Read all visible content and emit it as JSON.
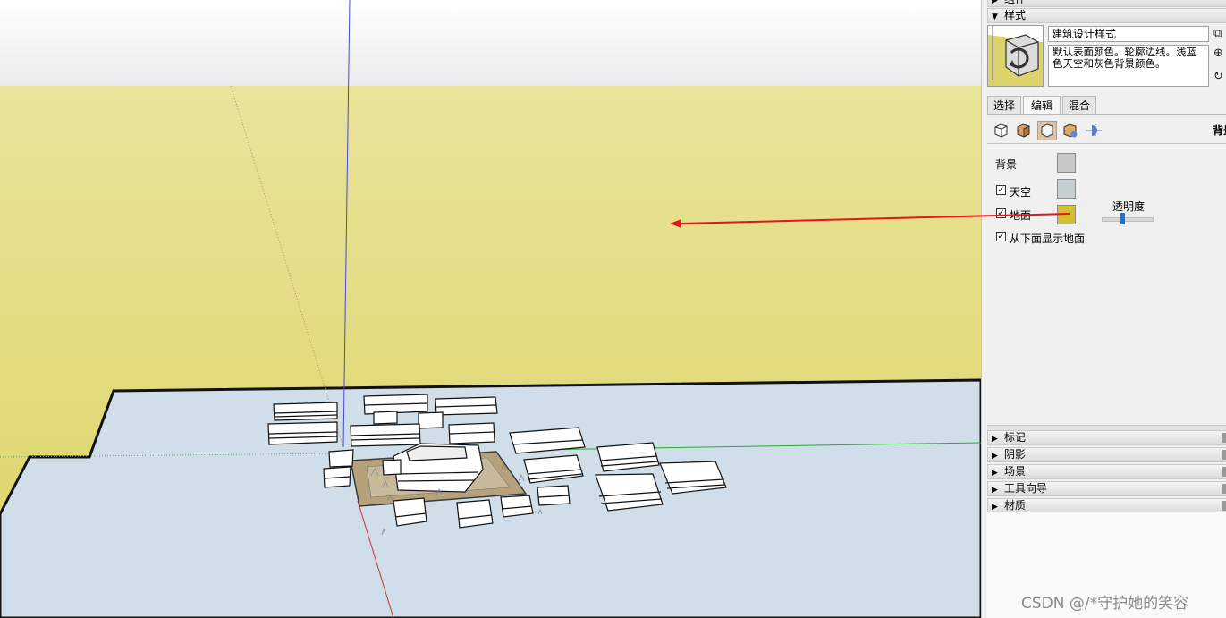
{
  "panel": {
    "top_cut_label": "组件",
    "styles_header": "样式",
    "style_name": "建筑设计样式",
    "style_description": "默认表面颜色。轮廓边线。浅蓝色天空和灰色背景颜色。",
    "tabs": [
      {
        "label": "选择",
        "active": false
      },
      {
        "label": "编辑",
        "active": true
      },
      {
        "label": "混合",
        "active": false
      }
    ],
    "edit_section_title": "背景",
    "background_settings": {
      "background_label": "背景",
      "background_color": "#c8c8c8",
      "sky_label": "天空",
      "sky_checked": true,
      "sky_color": "#c5ced3",
      "ground_label": "地面",
      "ground_checked": true,
      "ground_color": "#d2c02e",
      "opacity_label": "透明度",
      "opacity_value": 0.4,
      "show_ground_below_label": "从下面显示地面",
      "show_ground_below_checked": true
    },
    "collapsed_trays": [
      {
        "label": "标记"
      },
      {
        "label": "阴影"
      },
      {
        "label": "场景"
      },
      {
        "label": "工具向导"
      },
      {
        "label": "材质"
      }
    ]
  },
  "colors": {
    "ground_yellow": "#e4dc78",
    "sky_top": "#f2f3f3",
    "floor": "#cfdee8",
    "annotation_arrow": "#e8141a"
  },
  "watermark": "CSDN @/*守护她的笑容"
}
